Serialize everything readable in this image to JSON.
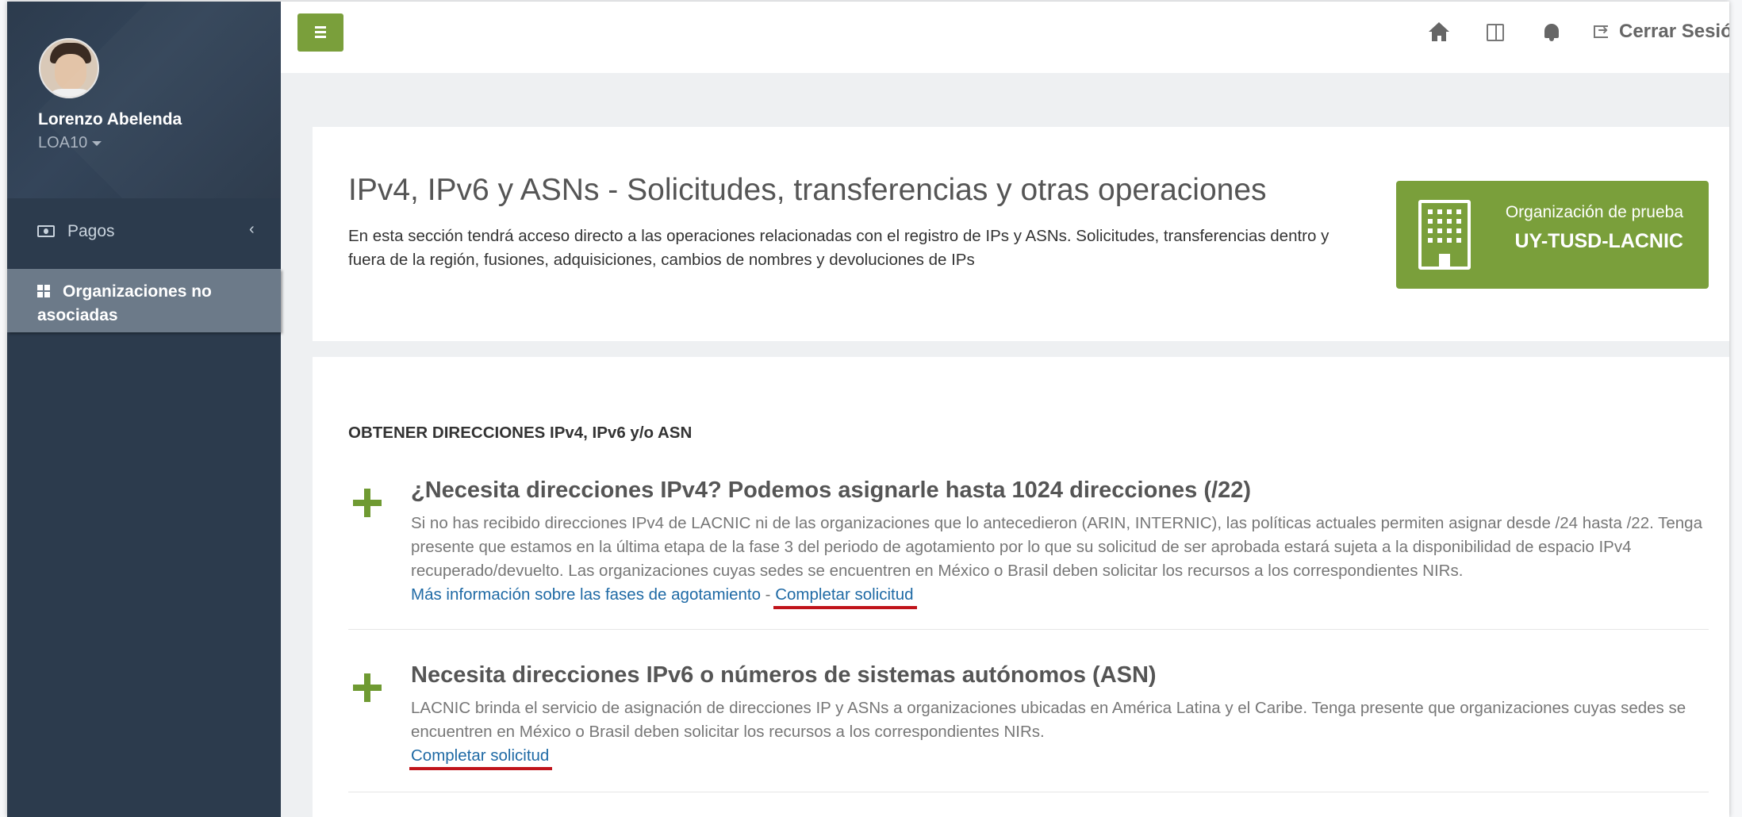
{
  "sidebar": {
    "user_name": "Lorenzo Abelenda",
    "user_code": "LOA10",
    "items": [
      {
        "label": "Pagos",
        "icon": "money-icon",
        "chevron": "‹"
      },
      {
        "label": "Organizaciones no asociadas",
        "icon": "dashboard-icon"
      }
    ]
  },
  "topbar": {
    "menu_icon": "menu-icon",
    "icons": [
      "home-icon",
      "language-icon",
      "bell-icon",
      "sign-out-icon"
    ],
    "signout_label": "Cerrar Sesión"
  },
  "header": {
    "title": "IPv4, IPv6 y ASNs - Solicitudes, transferencias y otras operaciones",
    "description": "En esta sección tendrá acceso directo a las operaciones relacionadas con el registro de IPs y ASNs. Solicitudes, transferencias dentro y fuera de la región, fusiones, adquisiciones, cambios de nombres y devoluciones de IPs",
    "org_label": "Organización de prueba",
    "org_code": "UY-TUSD-LACNIC"
  },
  "content": {
    "section_title": "OBTENER DIRECCIONES IPv4, IPv6 y/o ASN",
    "items": [
      {
        "title": "¿Necesita direcciones IPv4? Podemos asignarle hasta 1024 direcciones (/22)",
        "description": "Si no has recibido direcciones IPv4 de LACNIC ni de las organizaciones que lo antecedieron (ARIN, INTERNIC), las políticas actuales permiten asignar desde /24 hasta /22. Tenga presente que estamos en la última etapa de la fase 3 del periodo de agotamiento por lo que su solicitud de ser aprobada estará sujeta a la disponibilidad de espacio IPv4 recuperado/devuelto. Las organizaciones cuyas sedes se encuentren en México o Brasil deben solicitar los recursos a los correspondientes NIRs.",
        "info_link": "Más información sobre las fases de agotamiento",
        "separator": " - ",
        "action_link": "Completar solicitud"
      },
      {
        "title": "Necesita direcciones IPv6 o números de sistemas autónomos (ASN)",
        "description": "LACNIC brinda el servicio de asignación de direcciones IP y ASNs a organizaciones ubicadas en América Latina y el Caribe. Tenga presente que organizaciones cuyas sedes se encuentren en México o Brasil deben solicitar los recursos a los correspondientes NIRs.",
        "action_link": "Completar solicitud"
      }
    ]
  },
  "colors": {
    "sidebar": "#2c3b4d",
    "sidebar_active": "#6c7a89",
    "accent_green": "#7a9f3b",
    "link_blue": "#1f6aa5",
    "annotation_red": "#c0141b"
  }
}
